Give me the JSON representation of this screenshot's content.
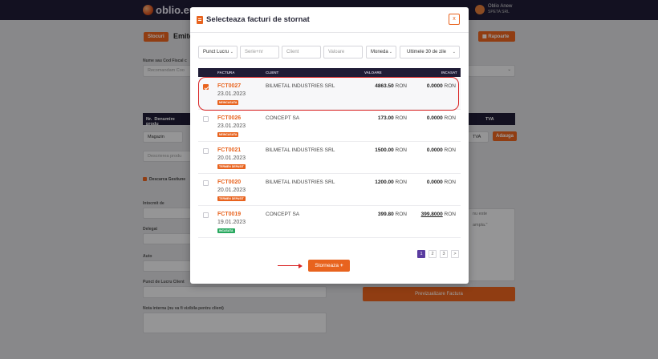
{
  "app": {
    "logo_text": "oblio.eu"
  },
  "user": {
    "name": "Oblio Anew",
    "company": "SPETA SRL"
  },
  "background": {
    "page_title": "Emite",
    "back_label": "Stocuri",
    "reports_label": "Rapoarte",
    "field_label_1": "Nume sau Cod Fiscal c",
    "field_value_1": "Recomandam Coo",
    "table_cols": [
      "Nr.",
      "Denumire produ",
      "TVA"
    ],
    "product_type": "Magazin",
    "product_placeholder": "Descrierea produ",
    "tva_value": "TVA",
    "add_label": "Adauga",
    "checkbox_label": "Descarca Gestiune",
    "labels": [
      "Intocmit de",
      "Delegat",
      "Auto",
      "Punct de Lucru Client",
      "Nota interna (nu va fi vizibila pentru client)"
    ],
    "preview_label": "Previzualizare Factura",
    "hint_1": "nu este",
    "hint_2": "ampla.\""
  },
  "modal": {
    "title": "Selecteaza facturi de stornat",
    "close_label": "x",
    "filters": {
      "punct_lucru": "Punct Lucru",
      "serie_nr": "Serie+nr",
      "client": "Client",
      "valoare": "Valoare",
      "moneda": "Moneda",
      "period": "Ultimele 30 de zile"
    },
    "columns": [
      "FACTURA",
      "CLIENT",
      "VALOARE",
      "INCASAT"
    ],
    "rows": [
      {
        "number": "FCT0027",
        "date": "23.01.2023",
        "badge": "NEINCASATA",
        "client": "BILMETAL INDUSTRIES SRL",
        "value": "4863.50",
        "value_currency": "RON",
        "paid": "0.0000",
        "paid_currency": "RON",
        "checked": true
      },
      {
        "number": "FCT0026",
        "date": "23.01.2023",
        "badge": "NEINCASATA",
        "client": "CONCEPT SA",
        "value": "173.00",
        "value_currency": "RON",
        "paid": "0.0000",
        "paid_currency": "RON",
        "checked": false
      },
      {
        "number": "FCT0021",
        "date": "20.01.2023",
        "badge": "TERMEN DEPASIT",
        "client": "BILMETAL INDUSTRIES SRL",
        "value": "1500.00",
        "value_currency": "RON",
        "paid": "0.0000",
        "paid_currency": "RON",
        "checked": false
      },
      {
        "number": "FCT0020",
        "date": "20.01.2023",
        "badge": "TERMEN DEPASIT",
        "client": "BILMETAL INDUSTRIES SRL",
        "value": "1200.00",
        "value_currency": "RON",
        "paid": "0.0000",
        "paid_currency": "RON",
        "checked": false
      },
      {
        "number": "FCT0019",
        "date": "19.01.2023",
        "badge": "INCASATA",
        "client": "CONCEPT SA",
        "value": "399.80",
        "value_currency": "RON",
        "paid": "399.8000",
        "paid_currency": "RON",
        "checked": false
      }
    ],
    "pagination": [
      "1",
      "2",
      "3",
      ">"
    ],
    "action_label": "Storneaza",
    "action_icon": "+"
  },
  "colors": {
    "accent": "#e8631e",
    "navy": "#1f1c36",
    "highlight": "#d92424",
    "paid_badge": "#27a85e"
  }
}
